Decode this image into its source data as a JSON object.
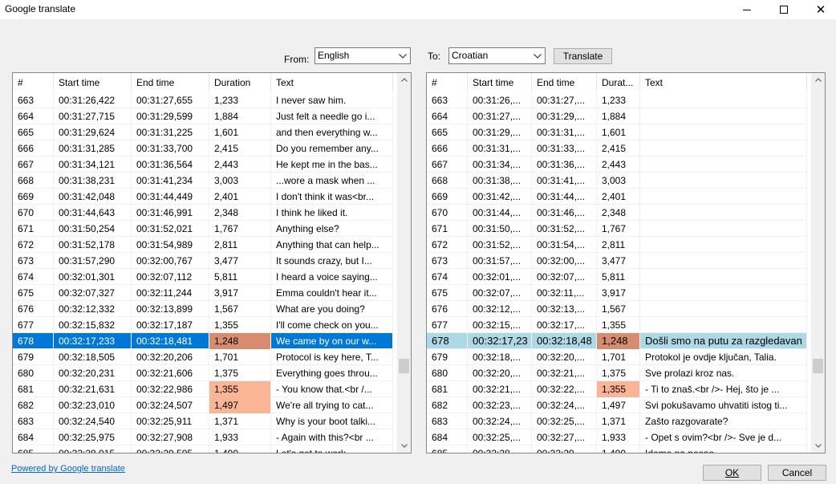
{
  "window": {
    "title": "Google translate"
  },
  "from": {
    "label": "From:",
    "value": "English"
  },
  "to": {
    "label": "To:",
    "value": "Croatian"
  },
  "translate_button": "Translate",
  "left_grid": {
    "headers": [
      "#",
      "Start time",
      "End time",
      "Duration",
      "Text"
    ],
    "rows": [
      {
        "n": "663",
        "start": "00:31:26,422",
        "end": "00:31:27,655",
        "dur": "1,233",
        "text": "I never saw him."
      },
      {
        "n": "664",
        "start": "00:31:27,715",
        "end": "00:31:29,599",
        "dur": "1,884",
        "text": "Just felt a needle go i..."
      },
      {
        "n": "665",
        "start": "00:31:29,624",
        "end": "00:31:31,225",
        "dur": "1,601",
        "text": "and then everything w..."
      },
      {
        "n": "666",
        "start": "00:31:31,285",
        "end": "00:31:33,700",
        "dur": "2,415",
        "text": "Do you remember any..."
      },
      {
        "n": "667",
        "start": "00:31:34,121",
        "end": "00:31:36,564",
        "dur": "2,443",
        "text": "He kept me in the bas..."
      },
      {
        "n": "668",
        "start": "00:31:38,231",
        "end": "00:31:41,234",
        "dur": "3,003",
        "text": "...wore a mask when ..."
      },
      {
        "n": "669",
        "start": "00:31:42,048",
        "end": "00:31:44,449",
        "dur": "2,401",
        "text": "I don't think it was<br..."
      },
      {
        "n": "670",
        "start": "00:31:44,643",
        "end": "00:31:46,991",
        "dur": "2,348",
        "text": "I think he liked it."
      },
      {
        "n": "671",
        "start": "00:31:50,254",
        "end": "00:31:52,021",
        "dur": "1,767",
        "text": "Anything else?"
      },
      {
        "n": "672",
        "start": "00:31:52,178",
        "end": "00:31:54,989",
        "dur": "2,811",
        "text": "Anything that can help..."
      },
      {
        "n": "673",
        "start": "00:31:57,290",
        "end": "00:32:00,767",
        "dur": "3,477",
        "text": "It sounds crazy, but I..."
      },
      {
        "n": "674",
        "start": "00:32:01,301",
        "end": "00:32:07,112",
        "dur": "5,811",
        "text": "I heard a voice saying..."
      },
      {
        "n": "675",
        "start": "00:32:07,327",
        "end": "00:32:11,244",
        "dur": "3,917",
        "text": "Emma couldn't hear it..."
      },
      {
        "n": "676",
        "start": "00:32:12,332",
        "end": "00:32:13,899",
        "dur": "1,567",
        "text": "What are you doing?"
      },
      {
        "n": "677",
        "start": "00:32:15,832",
        "end": "00:32:17,187",
        "dur": "1,355",
        "text": "I'll come check on you..."
      },
      {
        "n": "678",
        "start": "00:32:17,233",
        "end": "00:32:18,481",
        "dur": "1,248",
        "text": "We came by on our w...",
        "selected": true,
        "dur_highlight": "red"
      },
      {
        "n": "679",
        "start": "00:32:18,505",
        "end": "00:32:20,206",
        "dur": "1,701",
        "text": "Protocol is key here, T..."
      },
      {
        "n": "680",
        "start": "00:32:20,231",
        "end": "00:32:21,606",
        "dur": "1,375",
        "text": "Everything goes throu..."
      },
      {
        "n": "681",
        "start": "00:32:21,631",
        "end": "00:32:22,986",
        "dur": "1,355",
        "text": "- You know that.<br /...",
        "dur_highlight": "orange"
      },
      {
        "n": "682",
        "start": "00:32:23,010",
        "end": "00:32:24,507",
        "dur": "1,497",
        "text": "We're all trying to cat...",
        "dur_highlight": "orange"
      },
      {
        "n": "683",
        "start": "00:32:24,540",
        "end": "00:32:25,911",
        "dur": "1,371",
        "text": "Why is your boot talki..."
      },
      {
        "n": "684",
        "start": "00:32:25,975",
        "end": "00:32:27,908",
        "dur": "1,933",
        "text": "- Again with this?<br ..."
      },
      {
        "n": "685",
        "start": "00:32:28,015",
        "end": "00:32:29,505",
        "dur": "1,490",
        "text": "Let's get to work."
      }
    ]
  },
  "right_grid": {
    "headers": [
      "#",
      "Start time",
      "End time",
      "Durat...",
      "Text"
    ],
    "rows": [
      {
        "n": "663",
        "start": "00:31:26,...",
        "end": "00:31:27,...",
        "dur": "1,233",
        "text": ""
      },
      {
        "n": "664",
        "start": "00:31:27,...",
        "end": "00:31:29,...",
        "dur": "1,884",
        "text": ""
      },
      {
        "n": "665",
        "start": "00:31:29,...",
        "end": "00:31:31,...",
        "dur": "1,601",
        "text": ""
      },
      {
        "n": "666",
        "start": "00:31:31,...",
        "end": "00:31:33,...",
        "dur": "2,415",
        "text": ""
      },
      {
        "n": "667",
        "start": "00:31:34,...",
        "end": "00:31:36,...",
        "dur": "2,443",
        "text": ""
      },
      {
        "n": "668",
        "start": "00:31:38,...",
        "end": "00:31:41,...",
        "dur": "3,003",
        "text": ""
      },
      {
        "n": "669",
        "start": "00:31:42,...",
        "end": "00:31:44,...",
        "dur": "2,401",
        "text": ""
      },
      {
        "n": "670",
        "start": "00:31:44,...",
        "end": "00:31:46,...",
        "dur": "2,348",
        "text": ""
      },
      {
        "n": "671",
        "start": "00:31:50,...",
        "end": "00:31:52,...",
        "dur": "1,767",
        "text": ""
      },
      {
        "n": "672",
        "start": "00:31:52,...",
        "end": "00:31:54,...",
        "dur": "2,811",
        "text": ""
      },
      {
        "n": "673",
        "start": "00:31:57,...",
        "end": "00:32:00,...",
        "dur": "3,477",
        "text": ""
      },
      {
        "n": "674",
        "start": "00:32:01,...",
        "end": "00:32:07,...",
        "dur": "5,811",
        "text": ""
      },
      {
        "n": "675",
        "start": "00:32:07,...",
        "end": "00:32:11,...",
        "dur": "3,917",
        "text": ""
      },
      {
        "n": "676",
        "start": "00:32:12,...",
        "end": "00:32:13,...",
        "dur": "1,567",
        "text": ""
      },
      {
        "n": "677",
        "start": "00:32:15,...",
        "end": "00:32:17,...",
        "dur": "1,355",
        "text": ""
      },
      {
        "n": "678",
        "start": "00:32:17,23",
        "end": "00:32:18,48",
        "dur": "1,248",
        "text": "Došli smo na putu za razgledavan",
        "selected": true,
        "dur_highlight": "red"
      },
      {
        "n": "679",
        "start": "00:32:18,...",
        "end": "00:32:20,...",
        "dur": "1,701",
        "text": "Protokol je ovdje ključan, Talia."
      },
      {
        "n": "680",
        "start": "00:32:20,...",
        "end": "00:32:21,...",
        "dur": "1,375",
        "text": "Sve prolazi kroz nas."
      },
      {
        "n": "681",
        "start": "00:32:21,...",
        "end": "00:32:22,...",
        "dur": "1,355",
        "text": "- Ti to znaš.<br />- Hej, što je ...",
        "dur_highlight": "orange"
      },
      {
        "n": "682",
        "start": "00:32:23,...",
        "end": "00:32:24,...",
        "dur": "1,497",
        "text": "Svi pokušavamo uhvatiti istog ti..."
      },
      {
        "n": "683",
        "start": "00:32:24,...",
        "end": "00:32:25,...",
        "dur": "1,371",
        "text": "Zašto razgovarate?"
      },
      {
        "n": "684",
        "start": "00:32:25,...",
        "end": "00:32:27,...",
        "dur": "1,933",
        "text": "- Opet s ovim?<br />- Sve je d..."
      },
      {
        "n": "685",
        "start": "00:32:28,...",
        "end": "00:32:29,...",
        "dur": "1,490",
        "text": "Idemo na posao."
      }
    ]
  },
  "footer": {
    "powered_link": "Powered by Google translate",
    "ok": "OK",
    "cancel": "Cancel"
  }
}
